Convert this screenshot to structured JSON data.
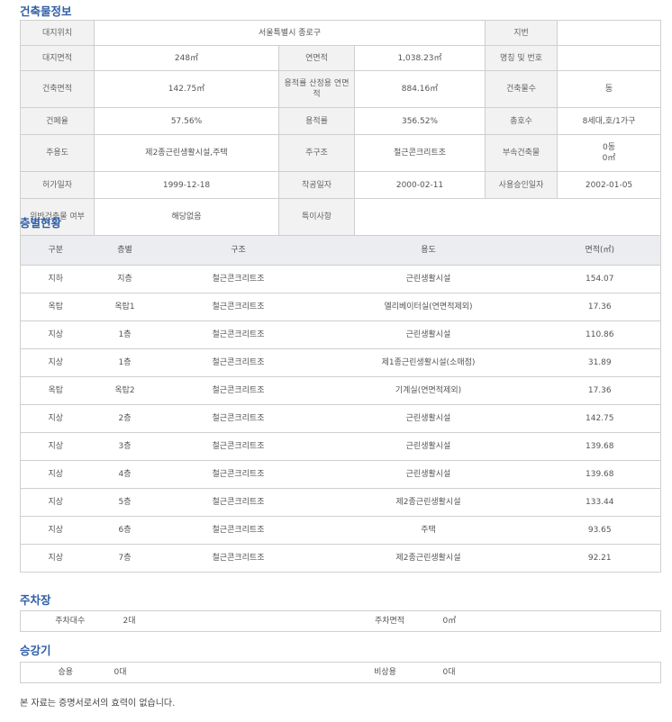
{
  "building_info": {
    "title": "건축물정보",
    "rows": [
      [
        {
          "l": "대지위치"
        },
        {
          "v": "서울특별시 종로구"
        },
        {
          "l": "지번"
        },
        {
          "v": ""
        }
      ],
      [
        {
          "l": "대지면적"
        },
        {
          "v": "248㎡"
        },
        {
          "l": "연면적"
        },
        {
          "v": "1,038.23㎡"
        },
        {
          "l": "명칭 및 번호"
        },
        {
          "v": ""
        }
      ],
      [
        {
          "l": "건축면적"
        },
        {
          "v": "142.75㎡"
        },
        {
          "l": "용적률 산정용 연면적"
        },
        {
          "v": "884.16㎡"
        },
        {
          "l": "건축물수"
        },
        {
          "v": "동"
        }
      ],
      [
        {
          "l": "건폐율"
        },
        {
          "v": "57.56%"
        },
        {
          "l": "용적률"
        },
        {
          "v": "356.52%"
        },
        {
          "l": "총호수"
        },
        {
          "v": "8세대,호/1가구"
        }
      ],
      [
        {
          "l": "주용도"
        },
        {
          "v": "제2종근린생활시설,주택"
        },
        {
          "l": "주구조"
        },
        {
          "v": "철근콘크리트조"
        },
        {
          "l": "부속건축물"
        },
        {
          "v": "0동\n0㎡"
        }
      ],
      [
        {
          "l": "허가일자"
        },
        {
          "v": "1999-12-18"
        },
        {
          "l": "착공일자"
        },
        {
          "v": "2000-02-11"
        },
        {
          "l": "사용승인일자"
        },
        {
          "v": "2002-01-05"
        }
      ],
      [
        {
          "l": "위반건축물 여부"
        },
        {
          "v": "해당없음"
        },
        {
          "l": "특이사항"
        },
        {
          "v": ""
        }
      ]
    ]
  },
  "floor_status": {
    "title": "층별현황",
    "headers": [
      "구분",
      "층별",
      "구조",
      "용도",
      "면적(㎡)"
    ],
    "rows": [
      [
        "지하",
        "지층",
        "철근콘크리트조",
        "근린생활시설",
        "154.07"
      ],
      [
        "옥탑",
        "옥탑1",
        "철근콘크리트조",
        "엘리베이터실(연면적제외)",
        "17.36"
      ],
      [
        "지상",
        "1층",
        "철근콘크리트조",
        "근린생활시설",
        "110.86"
      ],
      [
        "지상",
        "1층",
        "철근콘크리트조",
        "제1종근린생활시설(소매점)",
        "31.89"
      ],
      [
        "옥탑",
        "옥탑2",
        "철근콘크리트조",
        "기계실(연면적제외)",
        "17.36"
      ],
      [
        "지상",
        "2층",
        "철근콘크리트조",
        "근린생활시설",
        "142.75"
      ],
      [
        "지상",
        "3층",
        "철근콘크리트조",
        "근린생활시설",
        "139.68"
      ],
      [
        "지상",
        "4층",
        "철근콘크리트조",
        "근린생활시설",
        "139.68"
      ],
      [
        "지상",
        "5층",
        "철근콘크리트조",
        "제2종근린생활시설",
        "133.44"
      ],
      [
        "지상",
        "6층",
        "철근콘크리트조",
        "주택",
        "93.65"
      ],
      [
        "지상",
        "7층",
        "철근콘크리트조",
        "제2종근린생활시설",
        "92.21"
      ]
    ]
  },
  "parking": {
    "title": "주차장",
    "count_label": "주차대수",
    "count_value": "2대",
    "area_label": "주차면적",
    "area_value": "0㎡"
  },
  "elevator": {
    "title": "승강기",
    "passenger_label": "승용",
    "passenger_value": "0대",
    "emergency_label": "비상용",
    "emergency_value": "0대"
  },
  "note": "본 자료는 증명서로서의 효력이 없습니다."
}
